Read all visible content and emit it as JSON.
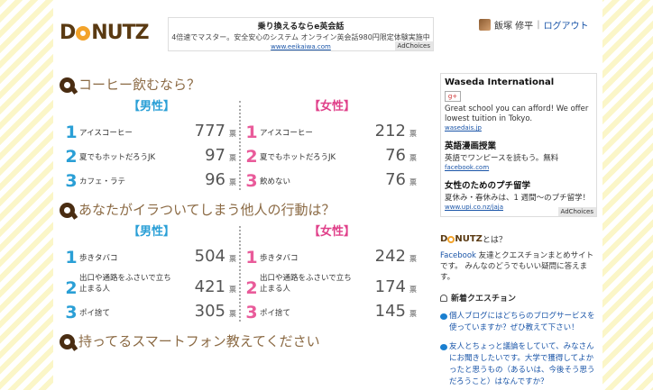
{
  "header": {
    "logo_text": [
      "D",
      "N",
      "U",
      "T",
      "Z"
    ],
    "top_ad": {
      "title": "乗り換えるならe英会話",
      "desc": "4倍速でマスター。安全安心のシステム オンライン英会話980円限定体験実施中",
      "url": "www.eeikaiwa.com",
      "adchoices": "AdChoices"
    },
    "user": {
      "name": "飯塚 修平",
      "sep": "|",
      "logout": "ログアウト"
    }
  },
  "questions": [
    {
      "title": "コーヒー飲むなら？",
      "male": {
        "label": "【男性】",
        "rows": [
          {
            "rank": "1",
            "answer": "アイスコーヒー",
            "count": "777",
            "unit": "票"
          },
          {
            "rank": "2",
            "answer": "夏でもホットだろうJK",
            "count": "97",
            "unit": "票"
          },
          {
            "rank": "3",
            "answer": "カフェ・ラテ",
            "count": "96",
            "unit": "票"
          }
        ]
      },
      "female": {
        "label": "【女性】",
        "rows": [
          {
            "rank": "1",
            "answer": "アイスコーヒー",
            "count": "212",
            "unit": "票"
          },
          {
            "rank": "2",
            "answer": "夏でもホットだろうJK",
            "count": "76",
            "unit": "票"
          },
          {
            "rank": "3",
            "answer": "飲めない",
            "count": "76",
            "unit": "票"
          }
        ]
      }
    },
    {
      "title": "あなたがイラついてしまう他人の行動は？",
      "male": {
        "label": "【男性】",
        "rows": [
          {
            "rank": "1",
            "answer": "歩きタバコ",
            "count": "504",
            "unit": "票"
          },
          {
            "rank": "2",
            "answer": "出口や通路をふさいで立ち止まる人",
            "count": "421",
            "unit": "票"
          },
          {
            "rank": "3",
            "answer": "ポイ捨て",
            "count": "305",
            "unit": "票"
          }
        ]
      },
      "female": {
        "label": "【女性】",
        "rows": [
          {
            "rank": "1",
            "answer": "歩きタバコ",
            "count": "242",
            "unit": "票"
          },
          {
            "rank": "2",
            "answer": "出口や通路をふさいで立ち止まる人",
            "count": "174",
            "unit": "票"
          },
          {
            "rank": "3",
            "answer": "ポイ捨て",
            "count": "145",
            "unit": "票"
          }
        ]
      }
    },
    {
      "title": "持ってるスマートフォン教えてください"
    }
  ],
  "sidebar": {
    "ad": {
      "title": "Waseda International",
      "icon": "g+",
      "text": "Great school you can afford! We offer lowest tuition in Tokyo.",
      "url": "wasedais.jp",
      "h2": "英語漫画授業",
      "t2": "英語でワンピースを読もう。無料",
      "u2": "facebook.com",
      "h3": "女性のためのプチ留学",
      "t3": "夏休み・春休みは、1 週間〜のプチ留学！",
      "u3": "www.upi.co.nz/jaja",
      "adchoices": "AdChoices"
    },
    "about": {
      "suffix": "とは？",
      "link": "Facebook",
      "text": "友達とクエスチョンまとめサイトです。 みんなのどうでもいい疑問に答えます。"
    },
    "new_q": {
      "title": "新着クエスチョン",
      "items": [
        "個人ブログにはどちらのブログサービスを使っていますか？ぜひ教えて下さい！",
        "友人とちょっと議論をしていて、みなさんにお聞きしたいです。大学で獲得してよかったと思うもの（あるいは、今後そう思うだろうこと）はなんですか？"
      ]
    }
  }
}
